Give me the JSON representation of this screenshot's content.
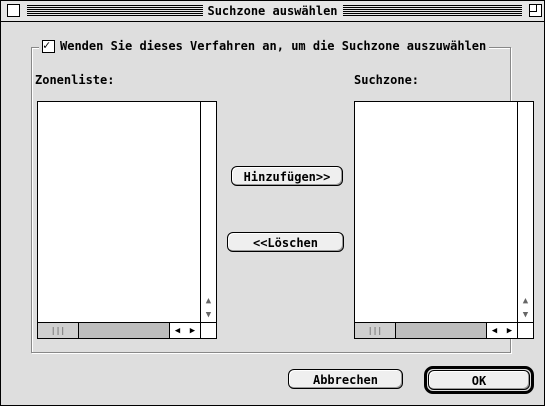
{
  "window": {
    "title": "Suchzone auswählen"
  },
  "group": {
    "checkbox_label": "Wenden Sie dieses Verfahren an, um die Suchzone auszuwählen",
    "checked": true
  },
  "left_list": {
    "label": "Zonenliste:",
    "items": []
  },
  "right_list": {
    "label": "Suchzone:",
    "items": []
  },
  "buttons": {
    "add": "Hinzufügen>>",
    "remove": "<<Löschen",
    "cancel": "Abbrechen",
    "ok": "OK"
  },
  "icons": {
    "scroll_up": "▲",
    "scroll_down": "▼",
    "scroll_left": "◀",
    "scroll_right": "▶",
    "thumb_grip": "|||"
  }
}
